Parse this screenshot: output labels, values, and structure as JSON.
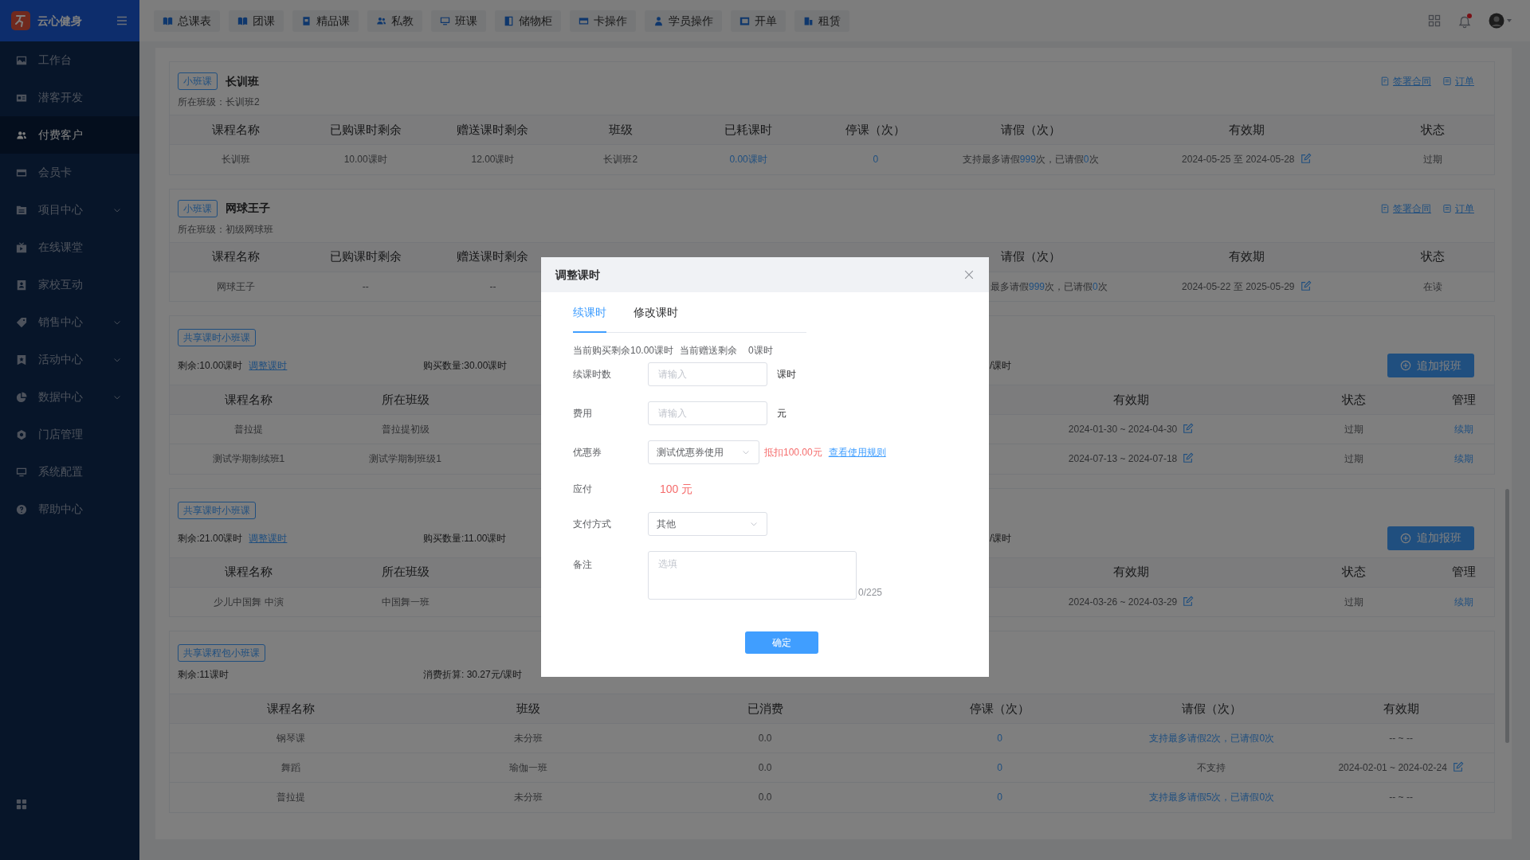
{
  "app": {
    "name": "云心健身"
  },
  "sidebar": {
    "items": [
      {
        "label": "工作台",
        "selected": false,
        "has_submenu": false
      },
      {
        "label": "潜客开发",
        "selected": false,
        "has_submenu": false
      },
      {
        "label": "付费客户",
        "selected": true,
        "has_submenu": false
      },
      {
        "label": "会员卡",
        "selected": false,
        "has_submenu": false
      },
      {
        "label": "项目中心",
        "selected": false,
        "has_submenu": true
      },
      {
        "label": "在线课堂",
        "selected": false,
        "has_submenu": false
      },
      {
        "label": "家校互动",
        "selected": false,
        "has_submenu": false
      },
      {
        "label": "销售中心",
        "selected": false,
        "has_submenu": true
      },
      {
        "label": "活动中心",
        "selected": false,
        "has_submenu": true
      },
      {
        "label": "数据中心",
        "selected": false,
        "has_submenu": true
      },
      {
        "label": "门店管理",
        "selected": false,
        "has_submenu": false
      },
      {
        "label": "系统配置",
        "selected": false,
        "has_submenu": false
      },
      {
        "label": "帮助中心",
        "selected": false,
        "has_submenu": false
      }
    ]
  },
  "top_nav": [
    "总课表",
    "团课",
    "精品课",
    "私教",
    "班课",
    "储物柜",
    "卡操作",
    "学员操作",
    "开单",
    "租赁"
  ],
  "cards": [
    {
      "kind": "class",
      "tag": "小班课",
      "title": "长训班",
      "subtitle": "所在班级：长训班2",
      "actions": [
        "签署合同",
        "订单"
      ],
      "columns": [
        "课程名称",
        "已购课时剩余",
        "赠送课时剩余",
        "班级",
        "已耗课时",
        "停课（次）",
        "请假（次）",
        "有效期",
        "状态"
      ],
      "rows": [
        [
          {
            "kind": "text",
            "text": "长训班"
          },
          {
            "kind": "text",
            "text": "10.00课时"
          },
          {
            "kind": "text",
            "text": "12.00课时"
          },
          {
            "kind": "text",
            "text": "长训班2"
          },
          {
            "kind": "link",
            "text": "0.00课时"
          },
          {
            "kind": "link",
            "text": "0"
          },
          {
            "kind": "leave",
            "parts": [
              {
                "text": "支持最多请假"
              },
              {
                "text": "999",
                "kind": "num"
              },
              {
                "text": "次，已请假"
              },
              {
                "text": "0",
                "kind": "num"
              },
              {
                "text": "次"
              }
            ]
          },
          {
            "kind": "date",
            "text": "2024-05-25 至 2024-05-28"
          },
          {
            "kind": "text",
            "text": "过期"
          }
        ]
      ]
    },
    {
      "kind": "class",
      "tag": "小班课",
      "title": "网球王子",
      "subtitle": "所在班级：初级网球班",
      "actions": [
        "签署合同",
        "订单"
      ],
      "columns": [
        "课程名称",
        "已购课时剩余",
        "赠送课时剩余",
        null,
        null,
        null,
        "请假（次）",
        "有效期",
        "状态"
      ],
      "rows": [
        [
          {
            "kind": "text",
            "text": "网球王子"
          },
          {
            "kind": "text",
            "text": "--"
          },
          {
            "kind": "text",
            "text": "--"
          },
          null,
          null,
          null,
          {
            "kind": "tail",
            "parts": [
              {
                "text": "最多请假"
              },
              {
                "text": "999",
                "kind": "num"
              },
              {
                "text": "次，已请假"
              },
              {
                "text": "0",
                "kind": "num"
              },
              {
                "text": "次"
              }
            ]
          },
          {
            "kind": "date",
            "text": "2024-05-22 至 2025-05-29"
          },
          {
            "kind": "text",
            "text": "在读"
          }
        ]
      ]
    },
    {
      "kind": "shared",
      "tag": "共享课时小班课",
      "remaining": "剩余:10.00课时",
      "adjust": "调整课时",
      "purchased": "购买数量:30.00课时",
      "tail": "/课时",
      "button": "追加报班",
      "columns": [
        "课程名称",
        "所在班级",
        null,
        "有效期",
        "状态",
        "管理"
      ],
      "rows": [
        [
          {
            "kind": "text",
            "text": "普拉提"
          },
          {
            "kind": "text",
            "text": "普拉提初级"
          },
          null,
          {
            "kind": "date",
            "text": "2024-01-30 ~ 2024-04-30"
          },
          {
            "kind": "text",
            "text": "过期"
          },
          {
            "kind": "link",
            "text": "续期"
          }
        ],
        [
          {
            "kind": "text",
            "text": "测试学期制续班1"
          },
          {
            "kind": "text",
            "text": "测试学期制班级1"
          },
          null,
          {
            "kind": "date",
            "text": "2024-07-13 ~ 2024-07-18"
          },
          {
            "kind": "text",
            "text": "过期"
          },
          {
            "kind": "link",
            "text": "续期"
          }
        ]
      ]
    },
    {
      "kind": "shared",
      "tag": "共享课时小班课",
      "remaining": "剩余:21.00课时",
      "adjust": "调整课时",
      "purchased": "购买数量:11.00课时",
      "tail": "/课时",
      "button": "追加报班",
      "columns": [
        "课程名称",
        "所在班级",
        null,
        "有效期",
        "状态",
        "管理"
      ],
      "rows": [
        [
          {
            "kind": "text",
            "text": "少儿中国舞 中演"
          },
          {
            "kind": "text",
            "text": "中国舞一班"
          },
          null,
          {
            "kind": "date",
            "text": "2024-03-26 ~ 2024-03-29"
          },
          {
            "kind": "text",
            "text": "过期"
          },
          {
            "kind": "link",
            "text": "续期"
          }
        ]
      ]
    },
    {
      "kind": "package",
      "tag": "共享课程包小班课",
      "remaining": "剩余:11课时",
      "rate": "消费折算: 30.27元/课时",
      "columns": [
        "课程名称",
        "班级",
        "已消费",
        "停课（次）",
        "请假（次）",
        "有效期"
      ],
      "rows": [
        [
          {
            "kind": "text",
            "text": "钢琴课"
          },
          {
            "kind": "text",
            "text": "未分班"
          },
          {
            "kind": "text",
            "text": "0.0"
          },
          {
            "kind": "link",
            "text": "0"
          },
          {
            "kind": "link",
            "text": "支持最多请假2次，已请假0次"
          },
          {
            "kind": "text",
            "text": "-- ~ --"
          }
        ],
        [
          {
            "kind": "text",
            "text": "舞蹈"
          },
          {
            "kind": "text",
            "text": "瑜伽一班"
          },
          {
            "kind": "text",
            "text": "0.0"
          },
          {
            "kind": "link",
            "text": "0"
          },
          {
            "kind": "text",
            "text": "不支持"
          },
          {
            "kind": "date",
            "text": "2024-02-01 ~ 2024-02-24"
          }
        ],
        [
          {
            "kind": "text",
            "text": "普拉提"
          },
          {
            "kind": "text",
            "text": "未分班"
          },
          {
            "kind": "text",
            "text": "0.0"
          },
          {
            "kind": "link",
            "text": "0"
          },
          {
            "kind": "link",
            "text": "支持最多请假5次，已请假0次"
          },
          {
            "kind": "text",
            "text": "-- ~ --"
          }
        ]
      ]
    }
  ],
  "dialog": {
    "title": "调整课时",
    "tabs": [
      {
        "label": "续课时",
        "selected": true
      },
      {
        "label": "修改课时",
        "selected": false
      }
    ],
    "summary": [
      "当前购买剩余10.00课时",
      "当前赠送剩余",
      "0课时"
    ],
    "fields": [
      {
        "kind": "input",
        "label": "续课时数",
        "placeholder": "请输入",
        "unit": "课时"
      },
      {
        "kind": "input",
        "label": "费用",
        "placeholder": "请输入",
        "unit": "元"
      },
      {
        "kind": "select",
        "label": "优惠券",
        "value": "测试优惠券使用",
        "note": "抵扣100.00元",
        "link": "查看使用规则"
      },
      {
        "kind": "amount",
        "label": "应付",
        "value": "100 元"
      },
      {
        "kind": "select",
        "label": "支付方式",
        "value": "其他"
      },
      {
        "kind": "textarea",
        "label": "备注",
        "placeholder": "选填",
        "counter": "0/225"
      }
    ],
    "confirm": "确定"
  }
}
